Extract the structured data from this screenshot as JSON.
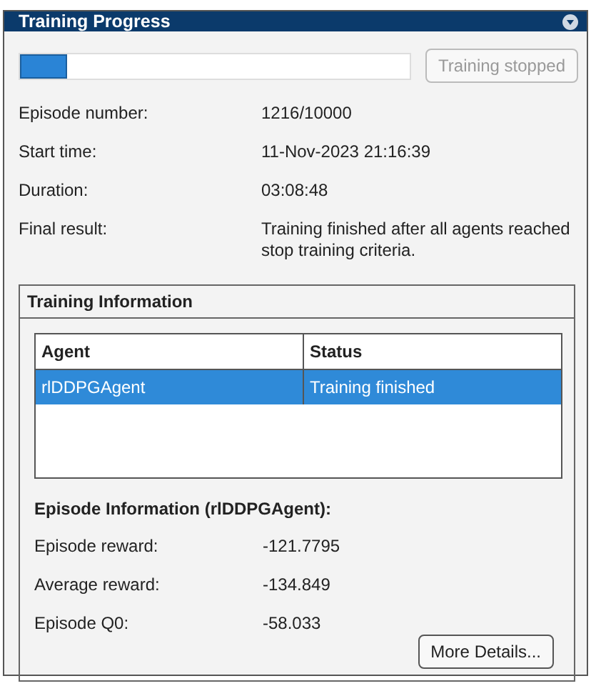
{
  "window": {
    "title": "Training Progress"
  },
  "progress": {
    "level": 0.12,
    "button": {
      "label": "Training stopped",
      "disabled": true
    }
  },
  "fields": [
    {
      "label": "Episode number:",
      "value": "1216/10000"
    },
    {
      "label": "Start time:",
      "value": "11-Nov-2023 21:16:39"
    },
    {
      "label": "Duration:",
      "value": "03:08:48"
    },
    {
      "label": "Final result:",
      "value": "Training finished after all agents reached stop training criteria."
    }
  ],
  "training_information": {
    "title": "Training Information",
    "table": {
      "columns": [
        "Agent",
        "Status"
      ],
      "rows": [
        {
          "cells": [
            "rlDDPGAgent",
            "Training finished"
          ],
          "selected": true
        }
      ]
    },
    "episode_information": {
      "title": "Episode Information (rlDDPGAgent):",
      "fields": [
        {
          "label": "Episode reward:",
          "value": "-121.7795"
        },
        {
          "label": "Average reward:",
          "value": "-134.849"
        },
        {
          "label": "Episode Q0:",
          "value": "-58.033"
        }
      ]
    },
    "button": "More Details..."
  }
}
